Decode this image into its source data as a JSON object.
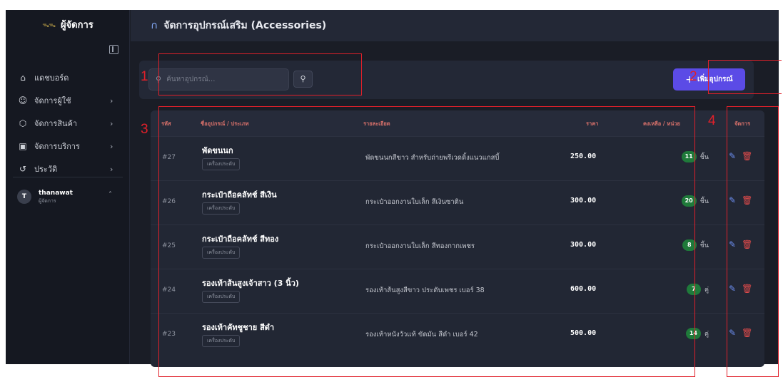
{
  "sidebar": {
    "brand": "ผู้จัดการ",
    "nav": [
      {
        "label": "แดชบอร์ด",
        "icon": "home-icon",
        "has_chevron": false
      },
      {
        "label": "จัดการผู้ใช้",
        "icon": "users-icon",
        "has_chevron": true
      },
      {
        "label": "จัดการสินค้า",
        "icon": "box-icon",
        "has_chevron": true
      },
      {
        "label": "จัดการบริการ",
        "icon": "briefcase-icon",
        "has_chevron": true
      },
      {
        "label": "ประวัติ",
        "icon": "history-icon",
        "has_chevron": true
      }
    ],
    "user": {
      "initial": "T",
      "name": "thanawat",
      "role": "ผู้จัดการ"
    }
  },
  "header": {
    "title": "จัดการอุปกรณ์เสริม (Accessories)",
    "icon": "headphones-icon"
  },
  "toolbar": {
    "search_placeholder": "ค้นหาอุปกรณ์...",
    "add_label": "เพิ่มอุปกรณ์"
  },
  "table": {
    "headers": {
      "id": "รหัส",
      "name": "ชื่ออุปกรณ์ / ประเภท",
      "desc": "รายละเอียด",
      "price": "ราคา",
      "stock": "คงเหลือ / หน่วย",
      "actions": "จัดการ"
    },
    "rows": [
      {
        "id": "#27",
        "name": "พัดขนนก",
        "category": "เครื่องประดับ",
        "desc": "พัดขนนกสีขาว สำหรับถ่ายพรีเวดดิ้งแนวแกสบี้",
        "price": "250.00",
        "stock": "11",
        "unit": "ชิ้น"
      },
      {
        "id": "#26",
        "name": "กระเป๋าถือคลัทช์ สีเงิน",
        "category": "เครื่องประดับ",
        "desc": "กระเป๋าออกงานใบเล็ก สีเงินซาติน",
        "price": "300.00",
        "stock": "20",
        "unit": "ชิ้น"
      },
      {
        "id": "#25",
        "name": "กระเป๋าถือคลัทช์ สีทอง",
        "category": "เครื่องประดับ",
        "desc": "กระเป๋าออกงานใบเล็ก สีทองกากเพชร",
        "price": "300.00",
        "stock": "8",
        "unit": "ชิ้น"
      },
      {
        "id": "#24",
        "name": "รองเท้าส้นสูงเจ้าสาว (3 นิ้ว)",
        "category": "เครื่องประดับ",
        "desc": "รองเท้าส้นสูงสีขาว ประดับเพชร เบอร์ 38",
        "price": "600.00",
        "stock": "7",
        "unit": "คู่"
      },
      {
        "id": "#23",
        "name": "รองเท้าคัทชูชาย สีดำ",
        "category": "เครื่องประดับ",
        "desc": "รองเท้าหนังวัวแท้ ขัดมัน สีดำ เบอร์ 42",
        "price": "500.00",
        "stock": "14",
        "unit": "คู่"
      }
    ]
  },
  "annotations": {
    "labels": [
      "1",
      "2",
      "3",
      "4"
    ],
    "color": "#e0202a"
  },
  "colors": {
    "accent": "#5b4be6",
    "badge": "#1f7a3a",
    "delete": "#e24b4b",
    "edit": "#6d8ff2",
    "header_text": "#d6706a"
  }
}
